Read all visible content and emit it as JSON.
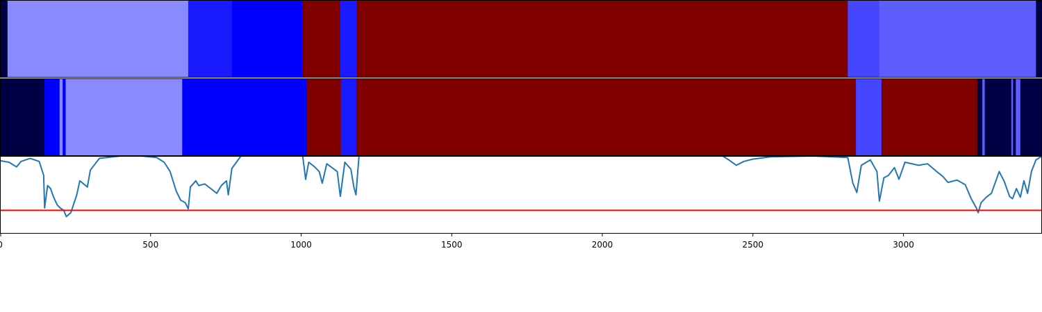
{
  "chart_data": {
    "type": "heatmap",
    "title": "",
    "xlabel": "",
    "ylabel": "",
    "xlim": [
      0,
      3460
    ],
    "xticks": [
      0,
      500,
      1000,
      1500,
      2000,
      2500,
      3000
    ],
    "grid": false,
    "colormap": "seismic",
    "rows": [
      {
        "segments": [
          {
            "start": 0,
            "end": 25,
            "color": "#000044"
          },
          {
            "start": 25,
            "end": 625,
            "color": "#8a8aff"
          },
          {
            "start": 625,
            "end": 770,
            "color": "#1a1aff"
          },
          {
            "start": 770,
            "end": 1005,
            "color": "#0000ff"
          },
          {
            "start": 1005,
            "end": 1130,
            "color": "#800000"
          },
          {
            "start": 1130,
            "end": 1185,
            "color": "#1a1aff"
          },
          {
            "start": 1185,
            "end": 2815,
            "color": "#800000"
          },
          {
            "start": 2815,
            "end": 2920,
            "color": "#4646ff"
          },
          {
            "start": 2920,
            "end": 3440,
            "color": "#5e5eff"
          },
          {
            "start": 3440,
            "end": 3460,
            "color": "#000044"
          }
        ]
      },
      {
        "segments": [
          {
            "start": 0,
            "end": 148,
            "color": "#000044"
          },
          {
            "start": 148,
            "end": 198,
            "color": "#0000ff"
          },
          {
            "start": 198,
            "end": 208,
            "color": "#8a8aff"
          },
          {
            "start": 208,
            "end": 218,
            "color": "#0000ff"
          },
          {
            "start": 218,
            "end": 605,
            "color": "#8a8aff"
          },
          {
            "start": 605,
            "end": 1018,
            "color": "#0000ff"
          },
          {
            "start": 1018,
            "end": 1132,
            "color": "#800000"
          },
          {
            "start": 1132,
            "end": 1183,
            "color": "#1a1aff"
          },
          {
            "start": 1183,
            "end": 2842,
            "color": "#800000"
          },
          {
            "start": 2842,
            "end": 2927,
            "color": "#4646ff"
          },
          {
            "start": 2927,
            "end": 3245,
            "color": "#800000"
          },
          {
            "start": 3245,
            "end": 3262,
            "color": "#000044"
          },
          {
            "start": 3262,
            "end": 3270,
            "color": "#5e5eff"
          },
          {
            "start": 3270,
            "end": 3358,
            "color": "#000044"
          },
          {
            "start": 3358,
            "end": 3364,
            "color": "#5e5eff"
          },
          {
            "start": 3364,
            "end": 3373,
            "color": "#000044"
          },
          {
            "start": 3373,
            "end": 3388,
            "color": "#5e5eff"
          },
          {
            "start": 3388,
            "end": 3460,
            "color": "#000044"
          }
        ]
      }
    ],
    "line_panel": {
      "ylim": [
        0,
        1
      ],
      "series": [
        {
          "color": "#1f77b4",
          "points": [
            [
              0,
              0.94
            ],
            [
              30,
              0.92
            ],
            [
              55,
              0.86
            ],
            [
              70,
              0.93
            ],
            [
              100,
              0.97
            ],
            [
              130,
              0.93
            ],
            [
              145,
              0.75
            ],
            [
              148,
              0.33
            ],
            [
              158,
              0.62
            ],
            [
              168,
              0.58
            ],
            [
              178,
              0.47
            ],
            [
              190,
              0.37
            ],
            [
              200,
              0.33
            ],
            [
              212,
              0.3
            ],
            [
              220,
              0.22
            ],
            [
              235,
              0.27
            ],
            [
              255,
              0.5
            ],
            [
              265,
              0.68
            ],
            [
              278,
              0.64
            ],
            [
              290,
              0.6
            ],
            [
              300,
              0.82
            ],
            [
              330,
              0.97
            ],
            [
              400,
              1.0
            ],
            [
              470,
              1.0
            ],
            [
              520,
              0.98
            ],
            [
              545,
              0.92
            ],
            [
              565,
              0.8
            ],
            [
              585,
              0.55
            ],
            [
              600,
              0.43
            ],
            [
              615,
              0.4
            ],
            [
              625,
              0.32
            ],
            [
              632,
              0.6
            ],
            [
              650,
              0.68
            ],
            [
              660,
              0.62
            ],
            [
              680,
              0.64
            ],
            [
              700,
              0.58
            ],
            [
              720,
              0.52
            ],
            [
              735,
              0.62
            ],
            [
              752,
              0.68
            ],
            [
              758,
              0.5
            ],
            [
              770,
              0.84
            ],
            [
              800,
              1.0
            ],
            [
              1005,
              1.0
            ],
            [
              1015,
              0.7
            ],
            [
              1025,
              0.92
            ],
            [
              1045,
              0.86
            ],
            [
              1060,
              0.8
            ],
            [
              1070,
              0.65
            ],
            [
              1085,
              0.9
            ],
            [
              1120,
              0.8
            ],
            [
              1130,
              0.48
            ],
            [
              1145,
              0.92
            ],
            [
              1165,
              0.83
            ],
            [
              1175,
              0.6
            ],
            [
              1182,
              0.5
            ],
            [
              1192,
              1.0
            ],
            [
              2400,
              1.0
            ],
            [
              2420,
              0.95
            ],
            [
              2445,
              0.88
            ],
            [
              2470,
              0.93
            ],
            [
              2500,
              0.96
            ],
            [
              2560,
              0.99
            ],
            [
              2700,
              1.0
            ],
            [
              2815,
              0.98
            ],
            [
              2832,
              0.65
            ],
            [
              2845,
              0.53
            ],
            [
              2860,
              0.88
            ],
            [
              2890,
              0.95
            ],
            [
              2912,
              0.8
            ],
            [
              2920,
              0.42
            ],
            [
              2935,
              0.72
            ],
            [
              2950,
              0.75
            ],
            [
              2970,
              0.85
            ],
            [
              2985,
              0.7
            ],
            [
              3005,
              0.92
            ],
            [
              3050,
              0.88
            ],
            [
              3080,
              0.9
            ],
            [
              3110,
              0.8
            ],
            [
              3130,
              0.74
            ],
            [
              3148,
              0.66
            ],
            [
              3178,
              0.69
            ],
            [
              3205,
              0.63
            ],
            [
              3225,
              0.45
            ],
            [
              3242,
              0.33
            ],
            [
              3248,
              0.27
            ],
            [
              3258,
              0.4
            ],
            [
              3275,
              0.47
            ],
            [
              3292,
              0.52
            ],
            [
              3318,
              0.8
            ],
            [
              3335,
              0.67
            ],
            [
              3352,
              0.48
            ],
            [
              3362,
              0.45
            ],
            [
              3375,
              0.58
            ],
            [
              3388,
              0.47
            ],
            [
              3400,
              0.68
            ],
            [
              3412,
              0.52
            ],
            [
              3425,
              0.8
            ],
            [
              3440,
              0.95
            ],
            [
              3460,
              1.0
            ]
          ]
        }
      ],
      "threshold": {
        "y": 0.3,
        "color": "#ff0000"
      }
    }
  }
}
